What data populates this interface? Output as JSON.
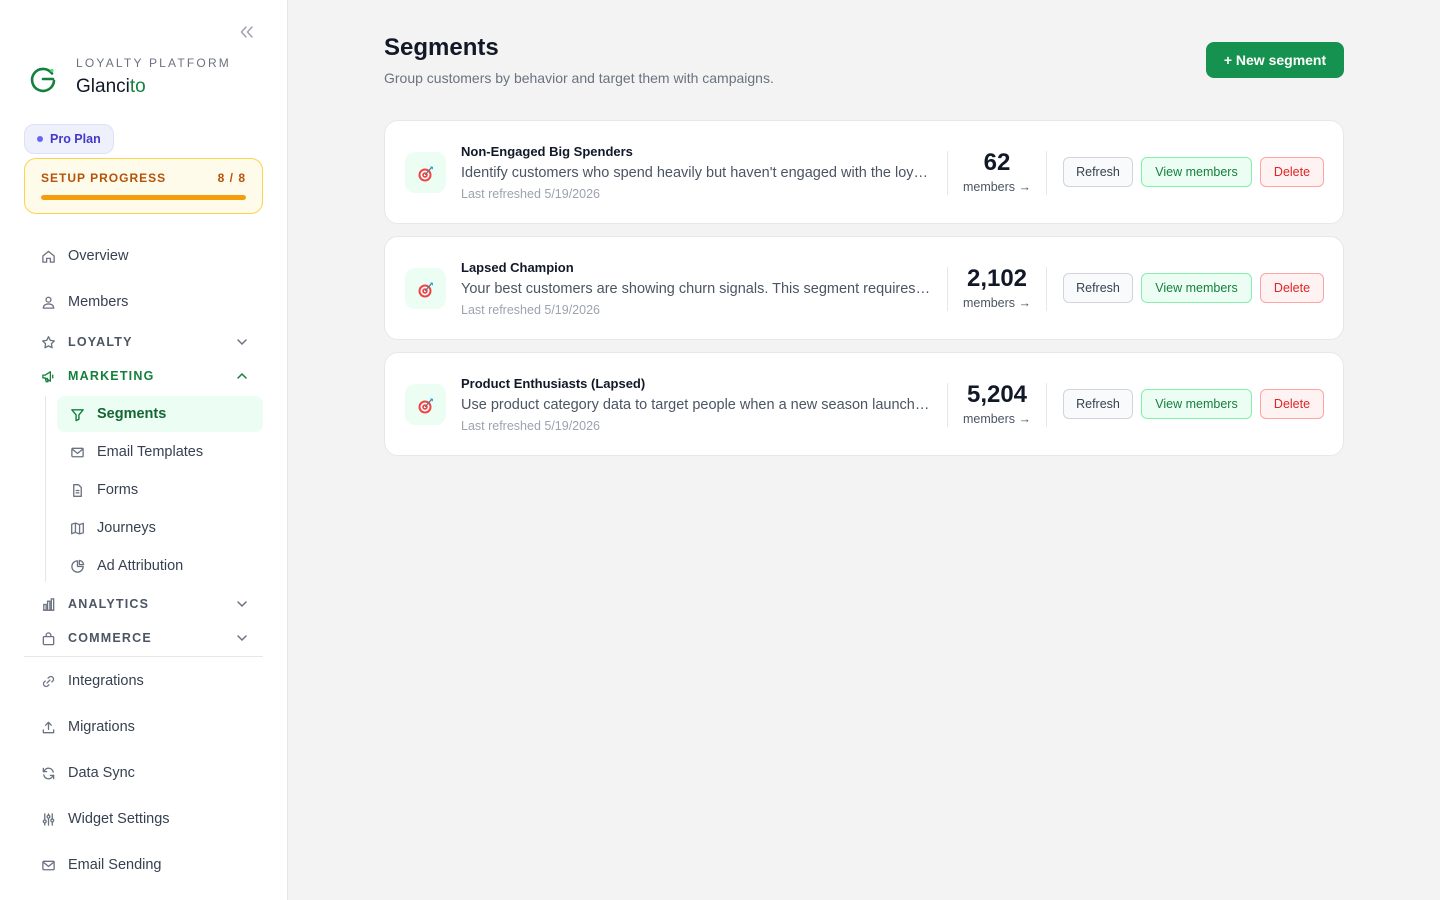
{
  "brand": {
    "eyebrow": "LOYALTY PLATFORM",
    "name_main": "Glanci",
    "name_accent": "to"
  },
  "plan": {
    "label": "Pro Plan"
  },
  "setup": {
    "label": "SETUP PROGRESS",
    "count": "8 / 8",
    "progress": 1.0
  },
  "nav": {
    "overview": "Overview",
    "members": "Members",
    "loyalty": "LOYALTY",
    "marketing": "MARKETING",
    "sub": {
      "segments": "Segments",
      "email_templates": "Email Templates",
      "forms": "Forms",
      "journeys": "Journeys",
      "ad_attribution": "Ad Attribution"
    },
    "analytics": "ANALYTICS",
    "commerce": "COMMERCE",
    "integrations": "Integrations",
    "migrations": "Migrations",
    "data_sync": "Data Sync",
    "widget_settings": "Widget Settings",
    "email_sending": "Email Sending"
  },
  "page": {
    "title": "Segments",
    "subtitle": "Group customers by behavior and target them with campaigns.",
    "new_button": "+ New segment"
  },
  "segments": [
    {
      "name": "Non-Engaged Big Spenders",
      "description": "Identify customers who spend heavily but haven't engaged with the loyalty program yet.",
      "refreshed": "Last refreshed 5/19/2026",
      "count": "62",
      "count_label": "members →",
      "refresh": "Refresh",
      "view": "View members",
      "delete": "Delete"
    },
    {
      "name": "Lapsed Champion",
      "description": "Your best customers are showing churn signals. This segment requires immediate attention.",
      "refreshed": "Last refreshed 5/19/2026",
      "count": "2,102",
      "count_label": "members →",
      "refresh": "Refresh",
      "view": "View members",
      "delete": "Delete"
    },
    {
      "name": "Product Enthusiasts (Lapsed)",
      "description": "Use product category data to target people when a new season launches in their category.",
      "refreshed": "Last refreshed 5/19/2026",
      "count": "5,204",
      "count_label": "members →",
      "refresh": "Refresh",
      "view": "View members",
      "delete": "Delete"
    }
  ]
}
